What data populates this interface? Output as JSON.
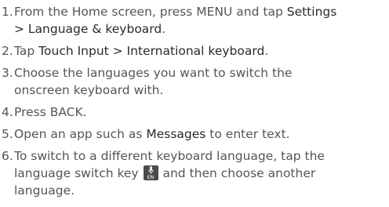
{
  "steps": [
    {
      "number": "1.",
      "lines": [
        {
          "a": "From the Home screen, press MENU and tap ",
          "b": "Settings"
        },
        {
          "a": "",
          "b": "> Language & keyboard",
          "c": "."
        }
      ]
    },
    {
      "number": "2.",
      "lines": [
        {
          "a": "Tap ",
          "b": "Touch Input > International keyboard",
          "c": "."
        }
      ]
    },
    {
      "number": "3.",
      "lines": [
        {
          "a": "Choose the languages you want to switch the"
        },
        {
          "a": "onscreen keyboard with."
        }
      ]
    },
    {
      "number": "4.",
      "lines": [
        {
          "a": "Press BACK."
        }
      ]
    },
    {
      "number": "5.",
      "lines": [
        {
          "a": "Open an app such as ",
          "b": "Messages",
          "c": " to enter text."
        }
      ]
    },
    {
      "number": "6.",
      "lines": [
        {
          "a": "To switch to a different keyboard language, tap the"
        },
        {
          "a": "language switch key ",
          "key_label": "EN",
          "c": " and then choose another"
        },
        {
          "a": "language."
        }
      ]
    }
  ],
  "icons": {
    "language_switch_key": "microphone-icon"
  }
}
